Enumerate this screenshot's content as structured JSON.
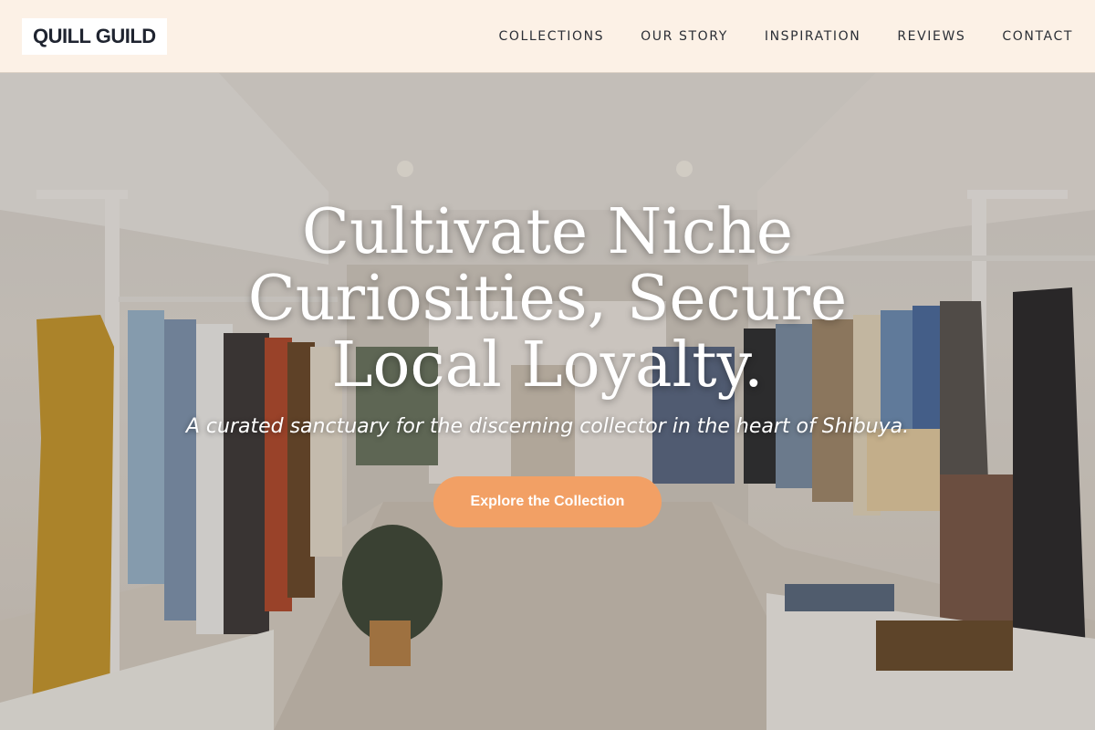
{
  "brand": {
    "name": "QUILL GUILD"
  },
  "nav": {
    "items": [
      {
        "label": "COLLECTIONS"
      },
      {
        "label": "OUR STORY"
      },
      {
        "label": "INSPIRATION"
      },
      {
        "label": "REVIEWS"
      },
      {
        "label": "CONTACT"
      }
    ]
  },
  "hero": {
    "title": "Cultivate Niche Curiosities, Secure Local Loyalty.",
    "subtitle": "A curated sanctuary for the discerning collector in the heart of Shibuya.",
    "cta_label": "Explore the Collection"
  },
  "colors": {
    "nav_background": "#fcf1e6",
    "cta_background": "#f2a065",
    "text_dark": "#1f2430"
  }
}
